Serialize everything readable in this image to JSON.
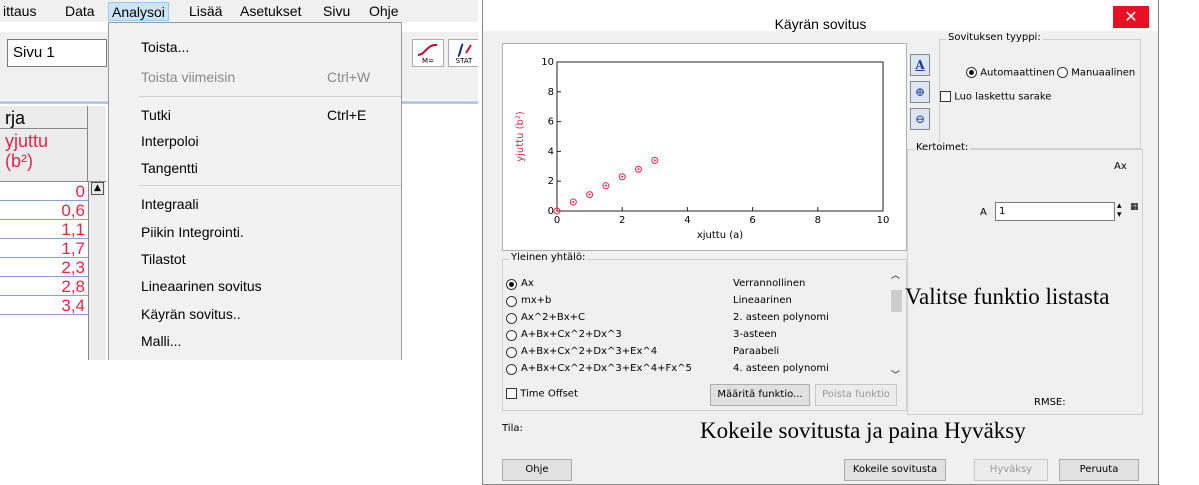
{
  "app": {
    "menu": [
      "ittaus",
      "Data",
      "Analysoi",
      "Lisää",
      "Asetukset",
      "Sivu",
      "Ohje"
    ],
    "active_menu": "Analysoi",
    "page_select": "Sivu 1",
    "toolbar_labels": {
      "m_eq": "M=",
      "stat": "STAT"
    },
    "table": {
      "column_name": "rja",
      "column_label_line1": "yjuttu",
      "column_label_line2": "(b²)",
      "values": [
        "0",
        "0,6",
        "1,1",
        "1,7",
        "2,3",
        "2,8",
        "3,4"
      ]
    },
    "dropdown": {
      "items": [
        {
          "label": "Toista...",
          "shortcut": "",
          "disabled": false
        },
        {
          "label": "Toista viimeisin",
          "shortcut": "Ctrl+W",
          "disabled": true
        },
        {
          "label": "Tutki",
          "shortcut": "Ctrl+E",
          "disabled": false
        },
        {
          "label": "Interpoloi",
          "shortcut": "",
          "disabled": false
        },
        {
          "label": "Tangentti",
          "shortcut": "",
          "disabled": false
        },
        {
          "label": "Integraali",
          "shortcut": "",
          "disabled": false
        },
        {
          "label": "Piikin Integrointi.",
          "shortcut": "",
          "disabled": false
        },
        {
          "label": "Tilastot",
          "shortcut": "",
          "disabled": false
        },
        {
          "label": "Lineaarinen sovitus",
          "shortcut": "",
          "disabled": false
        },
        {
          "label": "Käyrän sovitus..",
          "shortcut": "",
          "disabled": false
        },
        {
          "label": "Malli...",
          "shortcut": "",
          "disabled": false
        }
      ]
    }
  },
  "dialog": {
    "title": "Käyrän sovitus",
    "close_symbol": "✕",
    "graph": {
      "xlabel": "xjuttu (a)",
      "ylabel": "yjuttu (b²)",
      "x_ticks": [
        "0",
        "2",
        "4",
        "6",
        "8",
        "10"
      ],
      "y_ticks": [
        "0",
        "2",
        "4",
        "6",
        "8",
        "10"
      ]
    },
    "fit_type": {
      "title": "Sovituksen tyyppi:",
      "automatic": "Automaattinen",
      "manual": "Manuaalinen",
      "selected": "automatic",
      "create_column": "Luo laskettu sarake"
    },
    "coefficients": {
      "title": "Kertoimet:",
      "equation": "Ax",
      "param_name": "A",
      "param_value": "1",
      "rmse_label": "RMSE:"
    },
    "general_equation": {
      "title": "Yleinen yhtälö:",
      "rows": [
        {
          "formula": "Ax",
          "name": "Verrannollinen",
          "selected": true
        },
        {
          "formula": "mx+b",
          "name": "Lineaarinen",
          "selected": false
        },
        {
          "formula": "Ax^2+Bx+C",
          "name": "2. asteen polynomi",
          "selected": false
        },
        {
          "formula": "A+Bx+Cx^2+Dx^3",
          "name": "3-asteen",
          "selected": false
        },
        {
          "formula": "A+Bx+Cx^2+Dx^3+Ex^4",
          "name": "Paraabeli",
          "selected": false
        },
        {
          "formula": "A+Bx+Cx^2+Dx^3+Ex^4+Fx^5",
          "name": "4. asteen polynomi",
          "selected": false
        }
      ],
      "time_offset": "Time Offset",
      "define_button": "Määritä funktio...",
      "remove_button": "Poista funktio"
    },
    "status_label": "Tila:",
    "buttons": {
      "help": "Ohje",
      "try_fit": "Kokeile sovitusta",
      "accept": "Hyväksy",
      "cancel": "Peruuta"
    }
  },
  "annotations": {
    "choose_function": "Valitse funktio listasta",
    "try_and_accept": "Kokeile sovitusta ja paina Hyväksy"
  },
  "chart_data": {
    "type": "scatter",
    "xlabel": "xjuttu (a)",
    "ylabel": "yjuttu (b²)",
    "xlim": [
      0,
      10
    ],
    "ylim": [
      0,
      10
    ],
    "x_ticks": [
      0,
      2,
      4,
      6,
      8,
      10
    ],
    "y_ticks": [
      0,
      2,
      4,
      6,
      8,
      10
    ],
    "grid": false,
    "points": [
      {
        "x": 0,
        "y": 0
      },
      {
        "x": 0.5,
        "y": 0.6
      },
      {
        "x": 1.0,
        "y": 1.1
      },
      {
        "x": 1.5,
        "y": 1.7
      },
      {
        "x": 2.0,
        "y": 2.3
      },
      {
        "x": 2.5,
        "y": 2.8
      },
      {
        "x": 3.0,
        "y": 3.4
      }
    ],
    "marker_color": "#e8234a"
  }
}
